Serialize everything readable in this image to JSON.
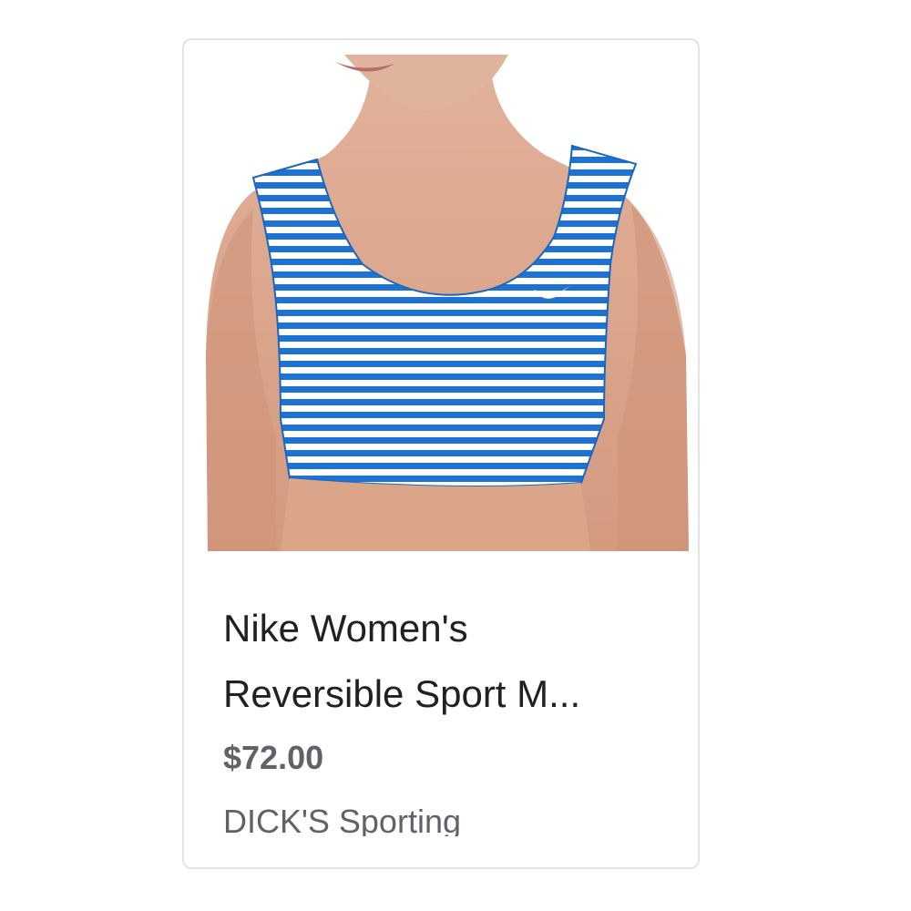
{
  "product": {
    "image_icon": "striped-sports-bra-photo",
    "title_line1": "Nike Women's",
    "title_line2": "Reversible Sport M...",
    "price": "$72.00",
    "seller": "DICK'S Sporting"
  },
  "colors": {
    "stripe_blue": "#1e73d2",
    "skin": "#d9a58c",
    "price_gray": "#5f6368",
    "title_dark": "#202124"
  }
}
